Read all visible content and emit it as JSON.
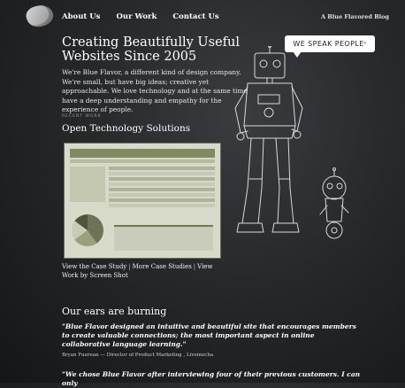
{
  "header": {
    "nav": [
      "About Us",
      "Our Work",
      "Contact Us"
    ],
    "blog_link": "A Blue Flavored Blog"
  },
  "hero": {
    "title": "Creating Beautifully Useful Websites Since 2005",
    "intro": "We're Blue Flavor, a different kind of design company. We're small, but have big ideas; creative yet approachable. We love technology and at the same time have a deep understanding and empathy for the experience of people."
  },
  "recent_work": {
    "label": "RECENT WORK",
    "title": "Open Technology Solutions",
    "links": {
      "case_study": "View the Case Study",
      "more_case_studies": "More Case Studies",
      "view_work": "View Work by Screen Shot",
      "separator": "|"
    }
  },
  "bubble": {
    "text": "WE SPEAK PEOPLE",
    "mark": "*"
  },
  "testimonials": {
    "title": "Our ears are burning",
    "quote1": "\"Blue Flavor designed an intuitive and beautiful site that encourages members to create valuable connections; the most important aspect in online collaborative language learning.\"",
    "attribution1": "Bryan Fuerean — Director of Product Marketing , Livemocha",
    "quote2": "\"We chose Blue Flavor after interviewing four of their previous customers. I can only"
  },
  "colors": {
    "background": "#26282a",
    "text": "#ffffff",
    "bubble": "#ffffff"
  }
}
